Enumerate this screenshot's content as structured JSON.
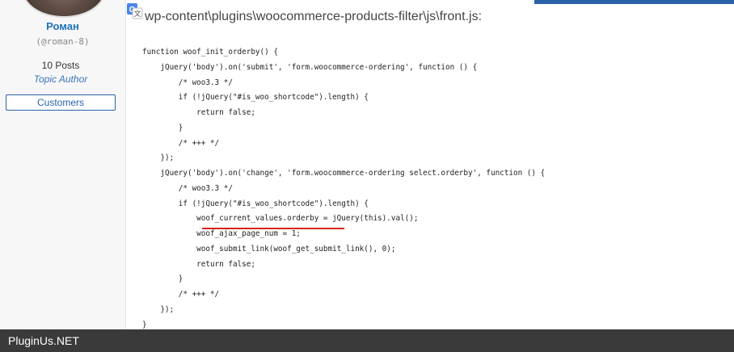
{
  "author": {
    "name": "Роман",
    "handle": "(@roman-8)",
    "posts": "10 Posts",
    "role_label": "Topic Author",
    "badge": "Customers"
  },
  "content": {
    "file_path": "wp-content\\plugins\\woocommerce-products-filter\\js\\front.js:",
    "code_lines": [
      "function woof_init_orderby() {",
      "    jQuery('body').on('submit', 'form.woocommerce-ordering', function () {",
      "        /* woo3.3 */",
      "        if (!jQuery(\"#is_woo_shortcode\").length) {",
      "            return false;",
      "        }",
      "        /* +++ */",
      "    });",
      "    jQuery('body').on('change', 'form.woocommerce-ordering select.orderby', function () {",
      "        /* woo3.3 */",
      "        if (!jQuery(\"#is_woo_shortcode\").length) {",
      "            woof_current_values.orderby = jQuery(this).val();",
      "            woof_ajax_page_num = 1;",
      "            woof_submit_link(woof_get_submit_link(), 0);",
      "            return false;",
      "        }",
      "        /* +++ */",
      "    });",
      "}"
    ]
  },
  "footer": {
    "brand": "PluginUs.NET"
  },
  "colors": {
    "accent": "#2a62a8",
    "highlight_underline": "#d7261b",
    "footer_bg": "#3a3a3a"
  }
}
